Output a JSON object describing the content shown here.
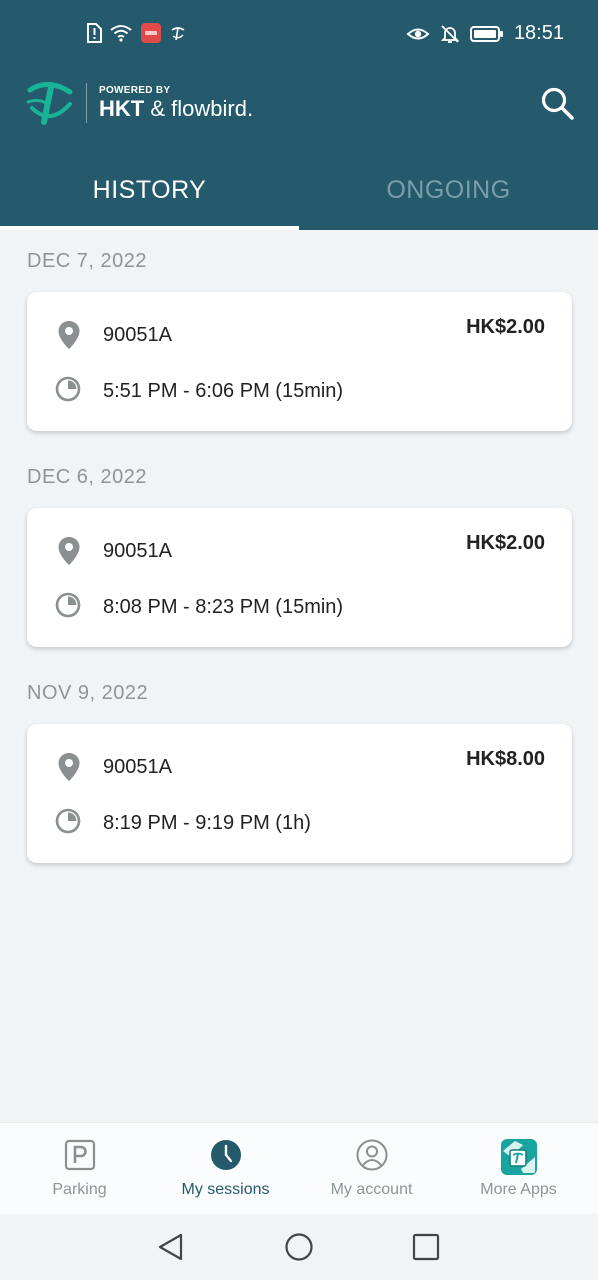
{
  "status_bar": {
    "time": "18:51"
  },
  "header": {
    "powered_by": "POWERED BY",
    "brand_hkt": "HKT",
    "brand_flowbird": "& flowbird."
  },
  "tabs": [
    {
      "label": "HISTORY",
      "active": true
    },
    {
      "label": "ONGOING",
      "active": false
    }
  ],
  "sessions": [
    {
      "date": "DEC 7, 2022",
      "location": "90051A",
      "time": "5:51 PM - 6:06 PM (15min)",
      "price": "HK$2.00"
    },
    {
      "date": "DEC 6, 2022",
      "location": "90051A",
      "time": "8:08 PM - 8:23 PM (15min)",
      "price": "HK$2.00"
    },
    {
      "date": "NOV 9, 2022",
      "location": "90051A",
      "time": "8:19 PM - 9:19 PM (1h)",
      "price": "HK$8.00"
    }
  ],
  "bottom_nav": [
    {
      "label": "Parking",
      "icon": "parking-icon"
    },
    {
      "label": "My sessions",
      "icon": "clock-icon",
      "active": true
    },
    {
      "label": "My account",
      "icon": "user-icon"
    },
    {
      "label": "More Apps",
      "icon": "more-apps-icon"
    }
  ],
  "colors": {
    "primary": "#245a6b",
    "background": "#f1f4f6",
    "inactive_text": "#8e9599"
  }
}
